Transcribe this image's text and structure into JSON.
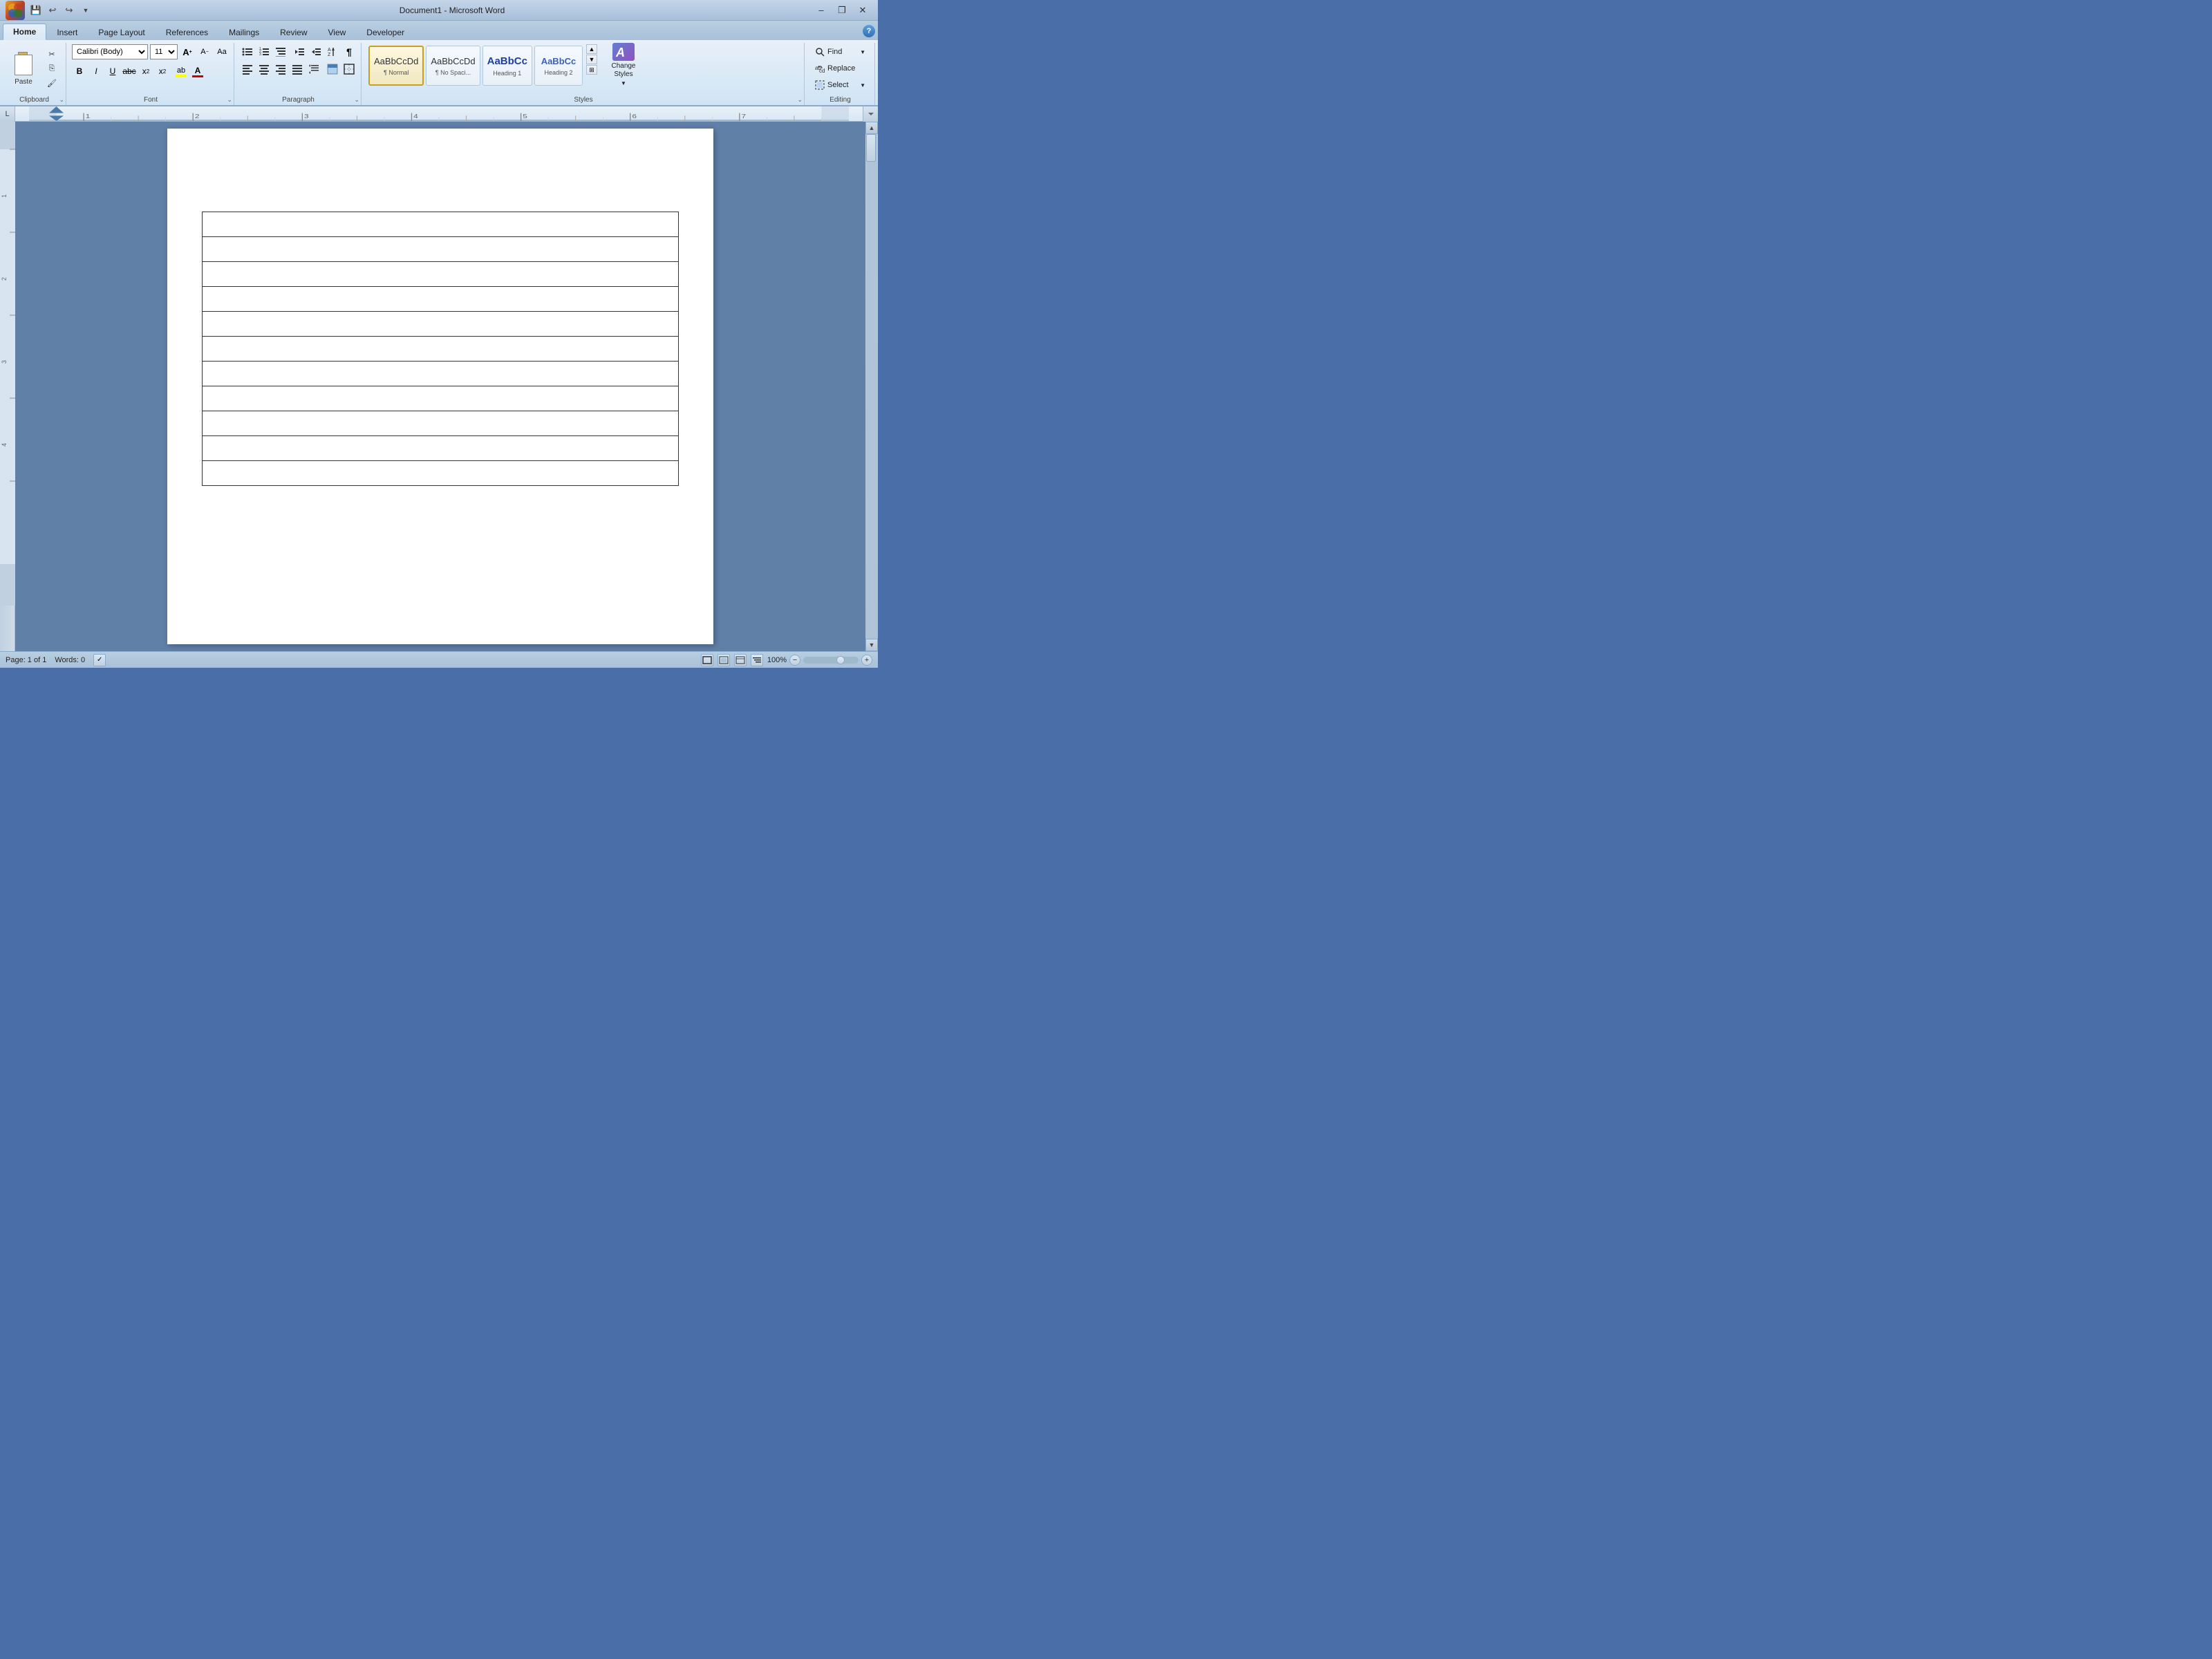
{
  "titleBar": {
    "title": "Document1 - Microsoft Word",
    "officeLogoLabel": "W",
    "quickAccess": {
      "save": "💾",
      "undo": "↩",
      "redo": "↪",
      "dropdown": "▼"
    },
    "windowControls": {
      "minimize": "–",
      "restore": "❐",
      "close": "✕"
    }
  },
  "ribbon": {
    "tabs": [
      "Home",
      "Insert",
      "Page Layout",
      "References",
      "Mailings",
      "Review",
      "View",
      "Developer"
    ],
    "activeTab": "Home",
    "groups": {
      "clipboard": {
        "label": "Clipboard",
        "paste": "Paste",
        "cut": "✂",
        "copy": "⎘",
        "formatPainter": "🖌"
      },
      "font": {
        "label": "Font",
        "fontName": "Calibri (Body)",
        "fontSize": "11",
        "increaseFont": "A",
        "decreaseFont": "A",
        "clearFormat": "Aa",
        "bold": "B",
        "italic": "I",
        "underline": "U",
        "strikethrough": "ab̶c̶",
        "subscript": "x₂",
        "superscript": "x²",
        "textHighlight": "ab",
        "fontColor": "A"
      },
      "paragraph": {
        "label": "Paragraph",
        "bullets": "≡",
        "numbering": "≡",
        "multilevel": "≡",
        "decreaseIndent": "⇤",
        "increaseIndent": "⇥",
        "sort": "↕",
        "showHide": "¶",
        "alignLeft": "≡",
        "alignCenter": "≡",
        "alignRight": "≡",
        "justify": "≡",
        "lineSpacing": "↕",
        "shading": "▓",
        "borders": "⊞"
      },
      "styles": {
        "label": "Styles",
        "items": [
          {
            "label": "¶ Normal",
            "sublabel": "Normal",
            "type": "normal",
            "active": true
          },
          {
            "label": "¶ No Spaci...",
            "sublabel": "No Spacing",
            "type": "nospacing",
            "active": false
          },
          {
            "label": "Heading 1",
            "sublabel": "Heading 1",
            "type": "heading1",
            "active": false
          },
          {
            "label": "Heading 2",
            "sublabel": "Heading 2",
            "type": "heading2",
            "active": false
          }
        ],
        "expandLabel": "Change Styles"
      },
      "editing": {
        "label": "Editing",
        "find": "Find",
        "replace": "Replace",
        "select": "Select",
        "findIcon": "🔍",
        "replaceIcon": "⇄",
        "selectIcon": "▦"
      }
    }
  },
  "ruler": {
    "leftBtnLabel": "L",
    "marks": [
      1,
      2,
      3,
      4,
      5,
      6,
      7
    ]
  },
  "document": {
    "tableRows": 11,
    "tableCols": 1
  },
  "statusBar": {
    "page": "Page: 1 of 1",
    "words": "Words: 0",
    "spellCheck": "✓",
    "viewIcons": [
      "📄",
      "📋",
      "📊",
      "📈"
    ],
    "zoom": "100%",
    "zoomMinus": "−",
    "zoomPlus": "+"
  }
}
